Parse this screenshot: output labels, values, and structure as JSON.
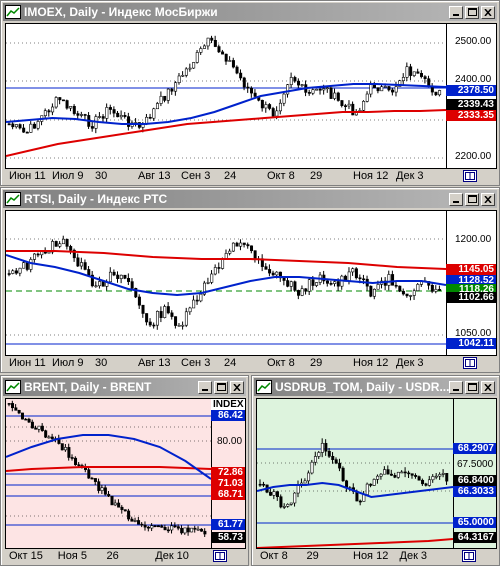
{
  "colors": {
    "blue": "#0022cc",
    "red": "#dd0000",
    "green": "#008800",
    "pink_bg": "#fde4e4",
    "green_bg": "#ddf3dd",
    "white_bg": "#ffffff"
  },
  "icons": {
    "app": "chart-icon",
    "minimize": "minimize-icon",
    "maximize": "maximize-icon",
    "close": "close-icon",
    "corner": "scale-toggle-icon"
  },
  "imoex": {
    "title": "IMOEX, Daily - Индекс МосБиржи",
    "ticks": [
      "2500.00",
      "2400.00",
      "2300.00",
      "2200.00"
    ],
    "price_labels": [
      {
        "text": "2378.50",
        "color": "#0022cc"
      },
      {
        "text": "2339.43",
        "color": "#ffffff"
      },
      {
        "text": "2333.35",
        "color": "#dd0000"
      }
    ],
    "xlabels": [
      "Июн 11",
      "Июл 9",
      "30",
      "Авг 13",
      "Сен 3",
      "24",
      "Окт 8",
      "29",
      "Ноя 12",
      "Дек 3"
    ]
  },
  "rtsi": {
    "title": "RTSI, Daily - Индекс РТС",
    "ticks": [
      "1200.00",
      "1050.00"
    ],
    "price_labels": [
      {
        "text": "1145.05",
        "color": "#dd0000"
      },
      {
        "text": "1128.52",
        "color": "#0022cc"
      },
      {
        "text": "1118.26",
        "color": "#008800"
      },
      {
        "text": "1102.66",
        "color": "#ffffff"
      },
      {
        "text": "1042.11",
        "color": "#0022cc"
      }
    ],
    "xlabels": [
      "Июн 11",
      "Июл 9",
      "30",
      "Авг 13",
      "Сен 3",
      "24",
      "Окт 8",
      "29",
      "Ноя 12",
      "Дек 3"
    ]
  },
  "brent": {
    "title": "BRENT, Daily - BRENT",
    "scale_header": "INDEX",
    "ticks": [
      "80.00"
    ],
    "price_labels": [
      {
        "text": "86.42",
        "color": "#0022cc"
      },
      {
        "text": "72.86",
        "color": "#0022cc"
      },
      {
        "text": "71.03",
        "color": "#0022cc"
      },
      {
        "text": "68.71",
        "color": "#0022cc"
      },
      {
        "text": "61.77",
        "color": "#0022cc"
      },
      {
        "text": "58.73",
        "color": "#ffffff"
      }
    ],
    "xlabels": [
      "Окт 15",
      "Ноя 5",
      "26",
      "Дек 10"
    ]
  },
  "usdrub": {
    "title": "USDRUB_TOM, Daily - USDR...",
    "ticks": [
      "67.5000"
    ],
    "price_labels": [
      {
        "text": "68.2907",
        "color": "#0022cc"
      },
      {
        "text": "66.8400",
        "color": "#ffffff"
      },
      {
        "text": "66.3033",
        "color": "#0022cc"
      },
      {
        "text": "65.0000",
        "color": "#0022cc"
      },
      {
        "text": "64.3167",
        "color": "#dd0000"
      }
    ],
    "xlabels": [
      "Окт 8",
      "29",
      "Ноя 12",
      "Дек 3"
    ]
  }
}
